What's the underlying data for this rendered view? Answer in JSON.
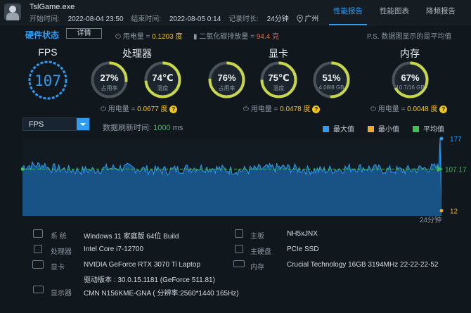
{
  "header": {
    "process_name": "TslGame.exe",
    "start_label": "开始时间: ",
    "start_time": "2022-08-04 23:50",
    "end_label": "结束时间: ",
    "end_time": "2022-08-05 0:14",
    "duration_label": "记录时长: ",
    "duration": "24分钟",
    "location": "广州",
    "tabs": [
      {
        "label": "性能报告",
        "active": true
      },
      {
        "label": "性能图表",
        "active": false
      },
      {
        "label": "降频报告",
        "active": false
      }
    ]
  },
  "hardware_status": {
    "title": "硬件状态",
    "details_label": "详情",
    "power_label": "用电量 = ",
    "power_value": "0.1203 度",
    "co2_label": "二氧化碳排放量 = ",
    "co2_value": "94.4 克",
    "note": "P.S. 数据图显示的是平均值"
  },
  "fps_panel": {
    "title": "FPS",
    "value": "107"
  },
  "cpu": {
    "title": "处理器",
    "usage": {
      "value": "27%",
      "label": "占用率",
      "fraction": 0.27
    },
    "temp": {
      "value": "74℃",
      "label": "温度",
      "fraction": 0.74
    },
    "power_label": "用电量 = ",
    "power_value": "0.0677 度"
  },
  "gpu": {
    "title": "显卡",
    "usage": {
      "value": "76%",
      "label": "占用率",
      "fraction": 0.76
    },
    "temp": {
      "value": "75℃",
      "label": "温度",
      "fraction": 0.75
    },
    "vram": {
      "value": "51%",
      "label": "4.08/8 GB",
      "fraction": 0.51
    },
    "power_label": "用电量 = ",
    "power_value": "0.0478 度"
  },
  "memory": {
    "title": "内存",
    "usage": {
      "value": "67%",
      "label": "10.7/16 GB",
      "fraction": 0.67
    },
    "power_label": "用电量 = ",
    "power_value": "0.0048 度"
  },
  "chart_controls": {
    "metric": "FPS",
    "refresh_label": "数据刷新时间: ",
    "refresh_value": "1000",
    "refresh_unit": " ms",
    "legend": [
      {
        "label": "最大值",
        "color": "#2f9cf1"
      },
      {
        "label": "最小值",
        "color": "#f0a92a"
      },
      {
        "label": "平均值",
        "color": "#3fbf5a"
      }
    ]
  },
  "chart_data": {
    "type": "area",
    "x_start_min": 0,
    "x_end_min": 24,
    "x_end_label": "24分钟",
    "ylim": [
      0,
      177
    ],
    "max": "177",
    "avg": "107.17",
    "min": "12",
    "max_value": 177,
    "avg_value": 107.17,
    "min_value": 12
  },
  "system_info": [
    {
      "label": "系  统",
      "value": "Windows 11 家庭版 64位   Build",
      "icon": "grid-icon"
    },
    {
      "label": "处理器",
      "value": "Intel Core i7-12700",
      "icon": "cpu-icon"
    },
    {
      "label": "显卡",
      "value": "NVIDIA GeForce RTX 3070 Ti Laptop",
      "value2": "驱动版本 : 30.0.15.1181 (GeForce 511.81)",
      "icon": "gpu-icon"
    },
    {
      "label": "显示器",
      "value": "CMN N156KME-GNA ( 分辨率:2560*1440 165Hz)",
      "icon": "monitor-icon"
    },
    {
      "label": "主板",
      "value": "NH5xJNX",
      "icon": "motherboard-icon"
    },
    {
      "label": "主硬盘",
      "value": "PCIe SSD",
      "icon": "disk-icon"
    },
    {
      "label": "内存",
      "value": "Crucial Technology 16GB 3194MHz 22-22-22-52",
      "icon": "ram-icon"
    }
  ]
}
